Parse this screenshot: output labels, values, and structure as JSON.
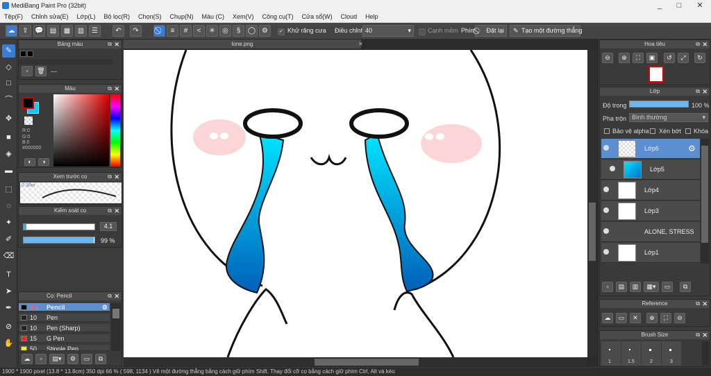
{
  "window": {
    "title": "MediBang Paint Pro (32bit)",
    "controls": [
      "_",
      "□",
      "✕"
    ]
  },
  "menu": [
    "Tệp(F)",
    "Chỉnh sửa(E)",
    "Lớp(L)",
    "Bộ lọc(R)",
    "Chọn(S)",
    "Chụp(N)",
    "Màu (C)",
    "Xem(V)",
    "Công cụ(T)",
    "Cửa sổ(W)",
    "Cloud",
    "Help"
  ],
  "toolbar": {
    "antialias_label": "Khử răng cưa",
    "adjust_label": "Điều chỉnh",
    "adjust_value": "40",
    "margin_label": "Cạnh mềm",
    "key_label": "Phím",
    "reset_label": "Đặt lại",
    "line_label": "Tạo một đường thẳng"
  },
  "panels": {
    "color_palette": {
      "title": "Bảng màu",
      "row_text": "---"
    },
    "color": {
      "title": "Màu",
      "r": "R:0",
      "g": "G:0",
      "b": "B:0",
      "hex": "#000000",
      "fg_color": "#000000",
      "bg_color": "#00ccff"
    },
    "preview": {
      "title": "Xem trước cọ",
      "size_text": "0.30m"
    },
    "brush_control": {
      "title": "Kiểm soát cọ",
      "size_value": "4.1",
      "opacity_value": "99 %"
    },
    "brush_list": {
      "title": "Cọ: Pencil",
      "items": [
        {
          "size": "4.1",
          "name": "Pencil",
          "color": "#000000"
        },
        {
          "size": "10",
          "name": "Pen",
          "color": "#222222"
        },
        {
          "size": "10",
          "name": "Pen (Sharp)",
          "color": "#222222"
        },
        {
          "size": "15",
          "name": "G Pen",
          "color": "#ff2222"
        },
        {
          "size": "50",
          "name": "Stipple Pen",
          "color": "#ffee00"
        }
      ]
    },
    "navigator": {
      "title": "Hoa tiêu"
    },
    "layer": {
      "title": "Lớp",
      "opacity_label": "Độ trong",
      "opacity_value": "100 %",
      "blend_label": "Pha trộn",
      "blend_value": "Bình thường",
      "protect_alpha": "Bảo vệ alpha",
      "clip": "Xén bớt",
      "lock": "Khóa",
      "items": [
        {
          "name": "Lớp6",
          "selected": true
        },
        {
          "name": "Lớp5"
        },
        {
          "name": "Lớp4"
        },
        {
          "name": "Lớp3"
        },
        {
          "name": "ALONE, STRESS"
        },
        {
          "name": "Lớp1"
        }
      ]
    },
    "reference": {
      "title": "Reference"
    },
    "brush_size": {
      "title": "Brush Size",
      "sizes": [
        "1",
        "1.5",
        "2",
        "3"
      ]
    }
  },
  "document": {
    "tab_name": "lone.png"
  },
  "status": {
    "text": "1900 * 1900 pixel (13.8 * 13.8cm)  350 dpi  66 %  ( 598, 1134 )  Vẽ một đường thẳng bằng cách giữ phím Shift. Thay đổi cỡ cọ bằng cách giữ phím Ctrl, Alt và kéo"
  }
}
